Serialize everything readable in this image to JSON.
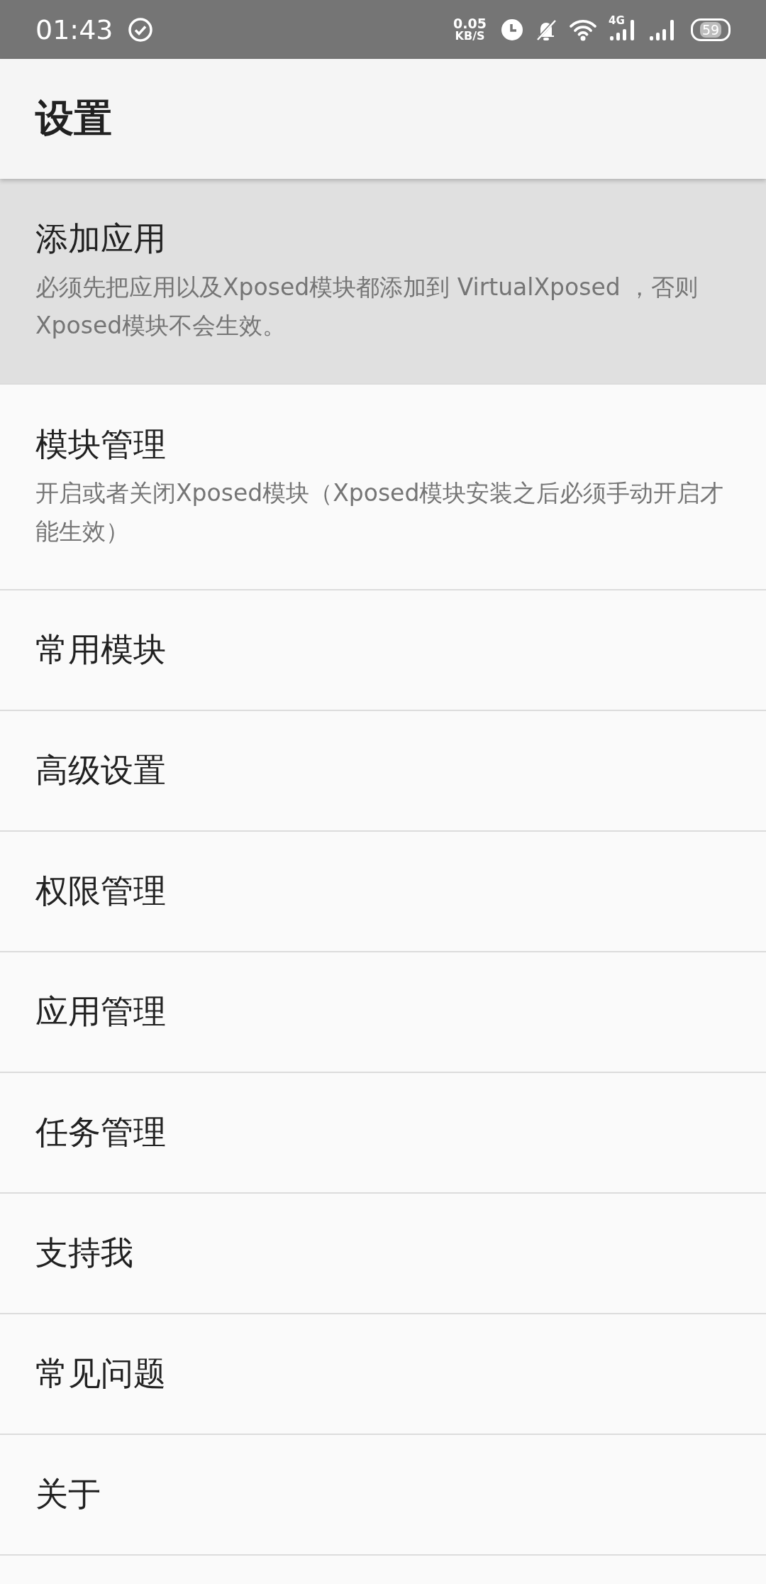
{
  "status_bar": {
    "time": "01:43",
    "net_speed": "0.05",
    "net_unit": "KB/S",
    "network_label": "4G",
    "battery": "59"
  },
  "toolbar": {
    "title": "设置"
  },
  "items": [
    {
      "title": "添加应用",
      "summary": "必须先把应用以及Xposed模块都添加到 VirtualXposed ，否则Xposed模块不会生效。",
      "selected": true
    },
    {
      "title": "模块管理",
      "summary": "开启或者关闭Xposed模块（Xposed模块安装之后必须手动开启才能生效）",
      "selected": false
    },
    {
      "title": "常用模块",
      "selected": false
    },
    {
      "title": "高级设置",
      "selected": false
    },
    {
      "title": "权限管理",
      "selected": false
    },
    {
      "title": "应用管理",
      "selected": false
    },
    {
      "title": "任务管理",
      "selected": false
    },
    {
      "title": "支持我",
      "selected": false
    },
    {
      "title": "常见问题",
      "selected": false
    },
    {
      "title": "关于",
      "selected": false
    }
  ]
}
